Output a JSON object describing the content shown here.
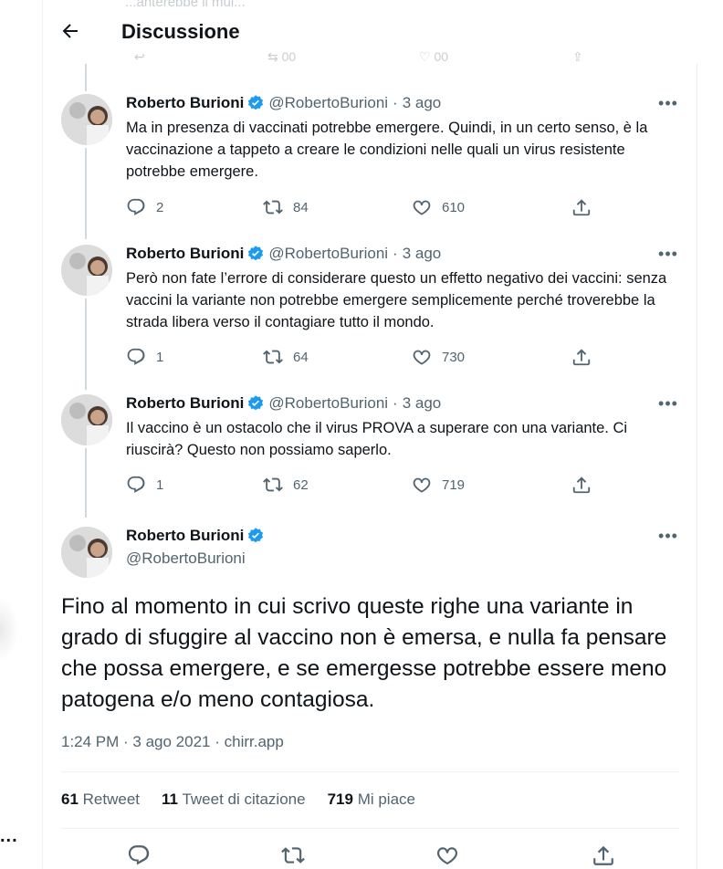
{
  "header": {
    "title": "Discussione",
    "back_icon": "arrow-left-icon",
    "ghost_text": "...anterebbe il mul..."
  },
  "author": {
    "name": "Roberto Burioni",
    "handle": "@RobertoBurioni"
  },
  "tweets": [
    {
      "time": "3 ago",
      "text": "Ma in presenza di vaccinati potrebbe emergere. Quindi, in un certo senso, è la vaccinazione a tappeto a creare le condizioni nelle quali un virus resistente potrebbe emergere.",
      "replies": "2",
      "retweets": "84",
      "likes": "610"
    },
    {
      "time": "3 ago",
      "text": "Però non fate l’errore di considerare questo un effetto negativo dei vaccini: senza vaccini la variante non potrebbe emergere semplicemente perché troverebbe la strada libera verso il contagiare tutto il mondo.",
      "replies": "1",
      "retweets": "64",
      "likes": "730"
    },
    {
      "time": "3 ago",
      "text": "Il vaccino è un ostacolo che il virus PROVA a superare con una variante. Ci riuscirà? Questo non possiamo saperlo.",
      "replies": "1",
      "retweets": "62",
      "likes": "719"
    }
  ],
  "main_tweet": {
    "text": "Fino al momento in cui scrivo queste righe una variante in grado di sfuggire al vaccino non è emersa, e nulla fa pensare che possa emergere, e se emergesse potrebbe essere meno patogena e/o meno contagiosa.",
    "meta": "1:24 PM · 3 ago 2021 · chirr.app",
    "retweets_count": "61",
    "retweets_label": "Retweet",
    "quotes_count": "11",
    "quotes_label": "Tweet di citazione",
    "likes_count": "719",
    "likes_label": "Mi piace"
  },
  "misc": {
    "dot_sep": "·",
    "more": "•••",
    "left_more": "..."
  },
  "colors": {
    "text": "#0f1419",
    "secondary": "#536471",
    "verified": "#1d9bf0",
    "line": "#cfd9de"
  }
}
